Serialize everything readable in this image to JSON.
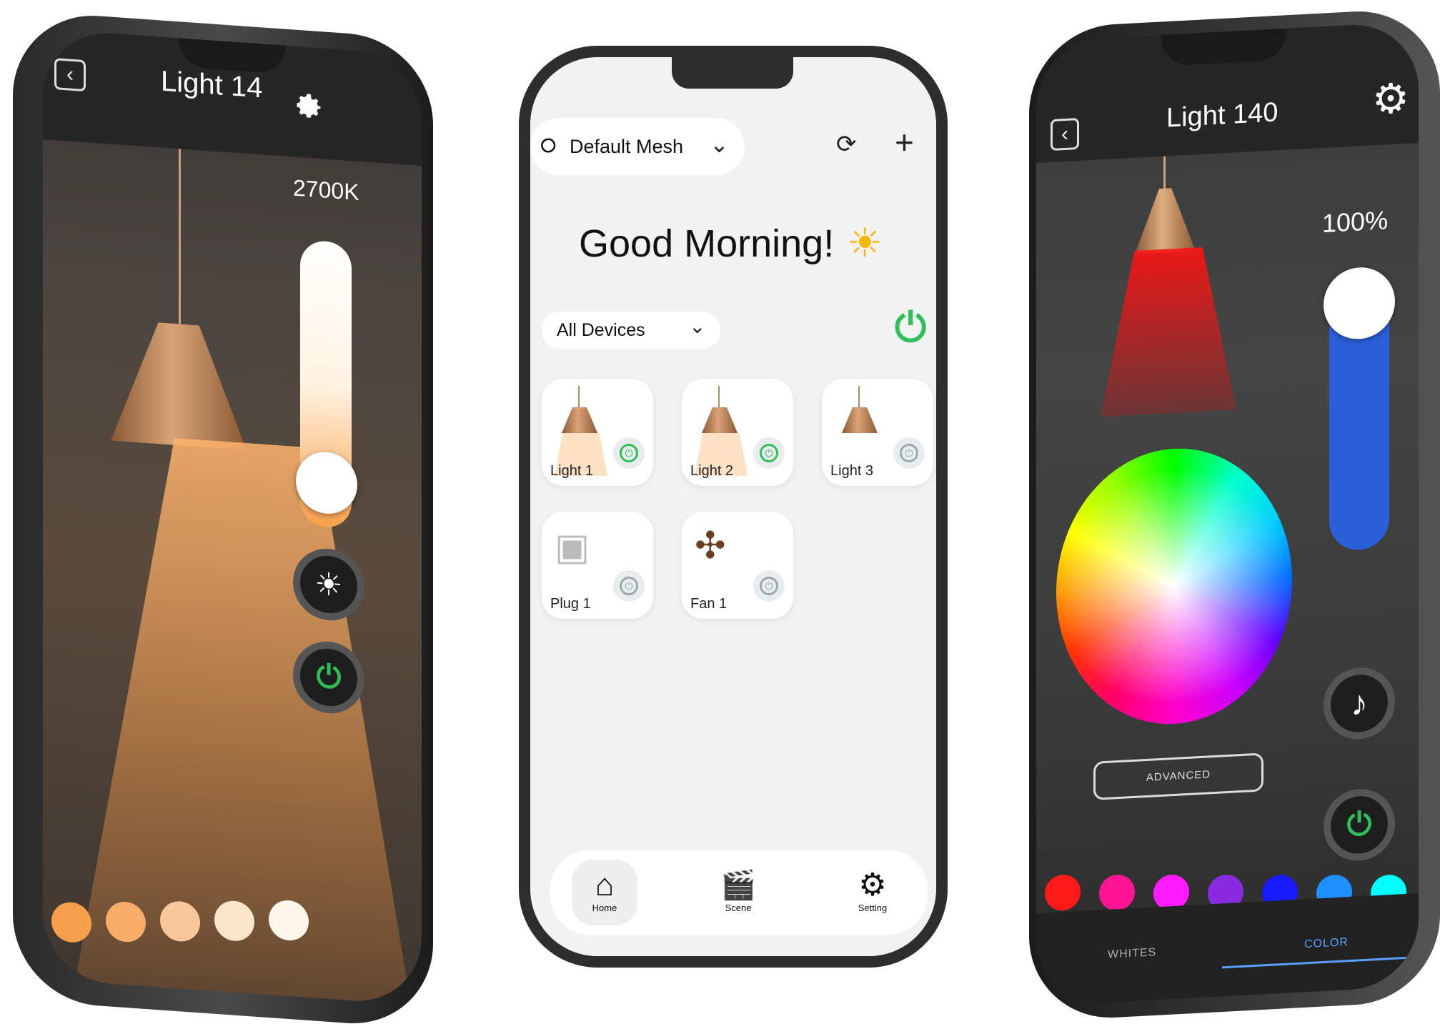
{
  "left_phone": {
    "title": "Light 14",
    "temperature": "2700K",
    "brightness_button_icon": "sun-icon",
    "power_button_icon": "power-icon",
    "temperature_swatches": [
      "#f7a04b",
      "#f7ad68",
      "#f8c79b",
      "#fbe4cc",
      "#fff6ea"
    ]
  },
  "center_phone": {
    "mesh_label": "Default Mesh",
    "greeting": "Good Morning!",
    "filter_label": "All Devices",
    "devices": [
      {
        "label": "Light 1",
        "on": true
      },
      {
        "label": "Light 2",
        "on": true
      },
      {
        "label": "Light 3",
        "on": false
      },
      {
        "label": "Plug 1",
        "on": false
      },
      {
        "label": "Fan 1",
        "on": false
      }
    ],
    "nav": {
      "home": "Home",
      "scene": "Scene",
      "setting": "Setting"
    },
    "colors": {
      "accent_green": "#2fbf5a"
    }
  },
  "right_phone": {
    "title": "Light 140",
    "brightness": "100%",
    "advanced_label": "ADVANCED",
    "tabs": {
      "whites": "WHITES",
      "color": "COLOR"
    },
    "color_swatches": [
      "#ff1a1a",
      "#ff1493",
      "#ff1aff",
      "#8a2be2",
      "#1a1aff",
      "#1e90ff",
      "#00ffff"
    ],
    "slider_color": "#2b5fd9"
  }
}
